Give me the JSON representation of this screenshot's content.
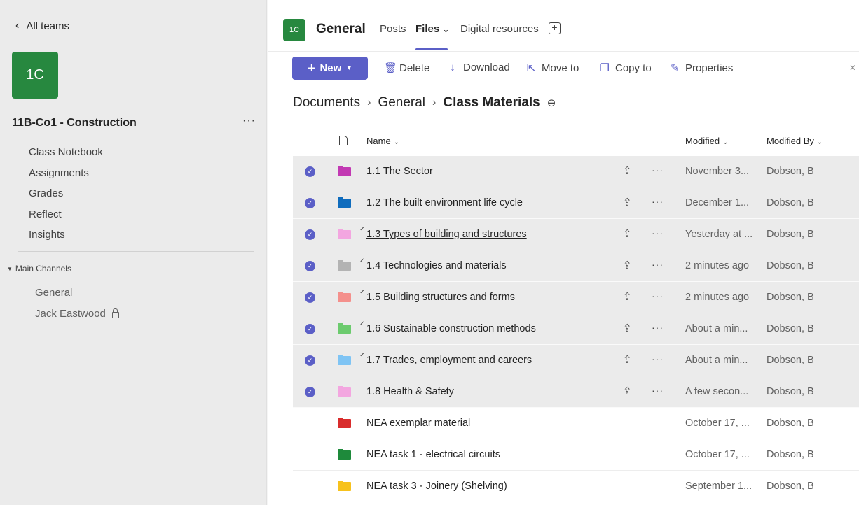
{
  "sidebar": {
    "back_label": "All teams",
    "team_initials": "1C",
    "team_name": "11B-Co1 - Construction",
    "more_label": "···",
    "nav_items": [
      {
        "label": "Class Notebook"
      },
      {
        "label": "Assignments"
      },
      {
        "label": "Grades"
      },
      {
        "label": "Reflect"
      },
      {
        "label": "Insights"
      }
    ],
    "channels_header": "Main Channels",
    "channels": [
      {
        "label": "General",
        "locked": false
      },
      {
        "label": "Jack Eastwood",
        "locked": true
      }
    ]
  },
  "header": {
    "channel_initials": "1C",
    "channel_title": "General",
    "tabs": [
      {
        "label": "Posts"
      },
      {
        "label": "Files"
      },
      {
        "label": "Digital resources"
      }
    ],
    "files_chevron": "⌄",
    "add_tab": "+"
  },
  "toolbar": {
    "new_label": "New",
    "actions": [
      {
        "label": "Delete",
        "icon": "trash-icon"
      },
      {
        "label": "Download",
        "icon": "download-icon"
      },
      {
        "label": "Move to",
        "icon": "move-icon"
      },
      {
        "label": "Copy to",
        "icon": "copy-icon"
      },
      {
        "label": "Properties",
        "icon": "pencil-icon"
      }
    ]
  },
  "breadcrumb": {
    "items": [
      "Documents",
      "General",
      "Class Materials"
    ]
  },
  "table": {
    "columns": {
      "name": "Name",
      "modified": "Modified",
      "modified_by": "Modified By"
    },
    "rows": [
      {
        "name": "1.1 The Sector",
        "modified": "November 3...",
        "modified_by": "Dobson, B",
        "selected": true,
        "syncing": false,
        "color": "#c239b3"
      },
      {
        "name": "1.2 The built environment life cycle",
        "modified": "December 1...",
        "modified_by": "Dobson, B",
        "selected": true,
        "syncing": false,
        "color": "#0f6cbd"
      },
      {
        "name": "1.3 Types of building and structures",
        "modified": "Yesterday at ...",
        "modified_by": "Dobson, B",
        "selected": true,
        "syncing": true,
        "underline": true,
        "color": "#f3a6e0"
      },
      {
        "name": "1.4 Technologies and materials",
        "modified": "2 minutes ago",
        "modified_by": "Dobson, B",
        "selected": true,
        "syncing": true,
        "color": "#b3b3b3"
      },
      {
        "name": "1.5 Building structures and forms",
        "modified": "2 minutes ago",
        "modified_by": "Dobson, B",
        "selected": true,
        "syncing": true,
        "color": "#f4908c"
      },
      {
        "name": "1.6 Sustainable construction methods",
        "modified": "About a min...",
        "modified_by": "Dobson, B",
        "selected": true,
        "syncing": true,
        "color": "#6ccb6e"
      },
      {
        "name": "1.7 Trades, employment and careers",
        "modified": "About a min...",
        "modified_by": "Dobson, B",
        "selected": true,
        "syncing": true,
        "color": "#7fc4f4"
      },
      {
        "name": "1.8 Health & Safety",
        "modified": "A few secon...",
        "modified_by": "Dobson, B",
        "selected": true,
        "syncing": false,
        "color": "#f3a6e0"
      },
      {
        "name": "NEA exemplar material",
        "modified": "October 17, ...",
        "modified_by": "Dobson, B",
        "selected": false,
        "syncing": false,
        "color": "#d92c2c"
      },
      {
        "name": "NEA task 1 - electrical circuits",
        "modified": "October 17, ...",
        "modified_by": "Dobson, B",
        "selected": false,
        "syncing": false,
        "color": "#1e8a3b"
      },
      {
        "name": "NEA task 3 - Joinery (Shelving)",
        "modified": "September 1...",
        "modified_by": "Dobson, B",
        "selected": false,
        "syncing": false,
        "color": "#f7c21d"
      }
    ]
  }
}
